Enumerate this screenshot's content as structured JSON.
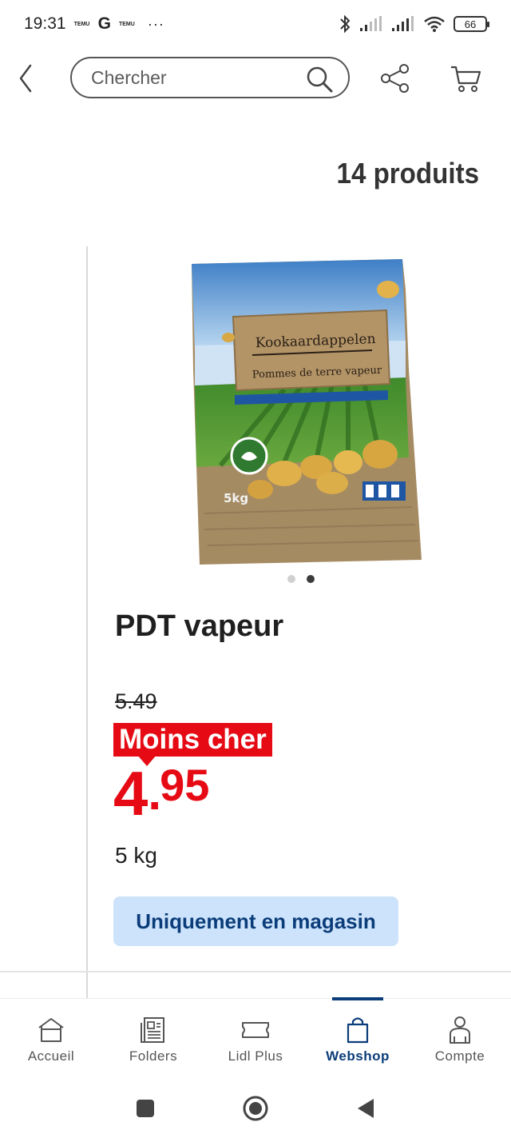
{
  "status_bar": {
    "time": "19:31",
    "app_badge_1": "TEMU",
    "google": "G",
    "app_badge_2": "TEMU",
    "more": "···",
    "battery": "66"
  },
  "header": {
    "search_placeholder": "Chercher"
  },
  "results": {
    "count_label": "14 produits"
  },
  "product": {
    "image_text": {
      "name_nl": "Kookaardappelen",
      "name_fr": "Pommes de terre vapeur",
      "weight": "5kg"
    },
    "carousel": {
      "count": 2,
      "active_index": 1
    },
    "title": "PDT vapeur",
    "old_price": "5.49",
    "badge": "Moins cher",
    "price_int": "4",
    "price_dec": "95",
    "unit": "5 kg",
    "availability": "Uniquement en magasin"
  },
  "bottom_nav": {
    "items": [
      {
        "label": "Accueil",
        "icon": "home-icon"
      },
      {
        "label": "Folders",
        "icon": "newspaper-icon"
      },
      {
        "label": "Lidl Plus",
        "icon": "ticket-icon"
      },
      {
        "label": "Webshop",
        "icon": "shopping-bag-icon",
        "active": true
      },
      {
        "label": "Compte",
        "icon": "user-icon"
      }
    ]
  },
  "colors": {
    "lidl_red": "#e60a14",
    "lidl_blue": "#0b3d7a",
    "pill_blue": "#cde3fb"
  }
}
